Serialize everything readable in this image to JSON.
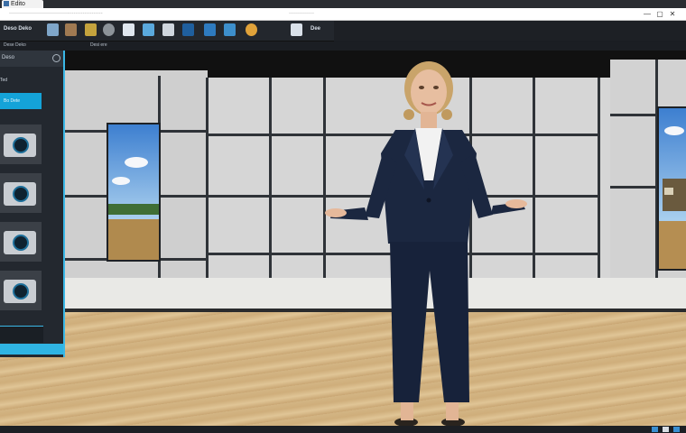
{
  "browser": {
    "tab_title": "Edito",
    "url_text": "····················································",
    "url_right": "··············",
    "window_buttons": [
      "—",
      "▢",
      "✕"
    ]
  },
  "toolbar": {
    "left_label": "Deso Deko",
    "right_label": "Dee",
    "icons": [
      "model-icon",
      "person-icon",
      "paint-icon",
      "sphere-icon",
      "light-icon",
      "cube-icon",
      "phone-icon",
      "screen-icon",
      "screen-icon",
      "globe-icon",
      "settings-icon"
    ]
  },
  "subbar": {
    "left": "Dese Deko",
    "right": "Desi ere"
  },
  "panel": {
    "title": "Deso",
    "tab": "Ted",
    "button": "Bo Dete",
    "thumbnails": [
      "camera-1",
      "camera-2",
      "camera-3",
      "camera-4"
    ]
  },
  "colors": {
    "accent": "#3ab7e6",
    "toolbar_bg": "#23272d"
  }
}
